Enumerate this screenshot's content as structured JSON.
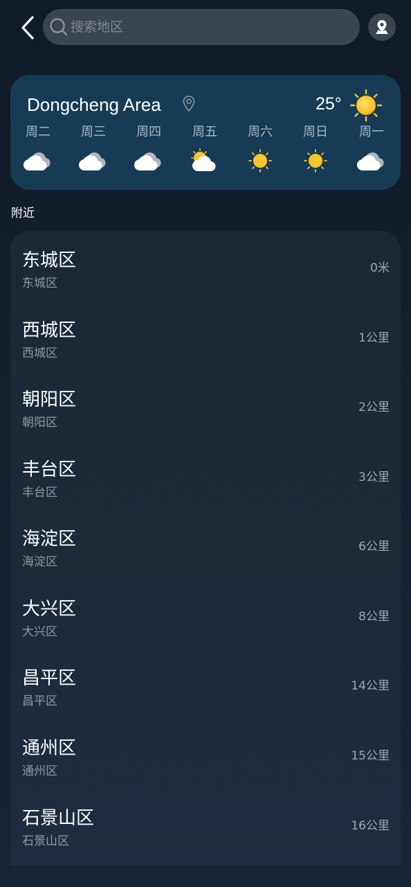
{
  "search": {
    "placeholder": "搜索地区"
  },
  "weather": {
    "city": "Dongcheng Area",
    "temperature": "25°",
    "forecast": [
      {
        "day": "周二",
        "icon": "cloudy-icon"
      },
      {
        "day": "周三",
        "icon": "cloudy-icon"
      },
      {
        "day": "周四",
        "icon": "cloudy-icon"
      },
      {
        "day": "周五",
        "icon": "partly-sunny-icon"
      },
      {
        "day": "周六",
        "icon": "sunny-icon"
      },
      {
        "day": "周日",
        "icon": "sunny-icon"
      },
      {
        "day": "周一",
        "icon": "cloudy-icon"
      }
    ]
  },
  "nearby": {
    "title": "附近",
    "items": [
      {
        "name": "东城区",
        "sub": "东城区",
        "distance": "0米"
      },
      {
        "name": "西城区",
        "sub": "西城区",
        "distance": "1公里"
      },
      {
        "name": "朝阳区",
        "sub": "朝阳区",
        "distance": "2公里"
      },
      {
        "name": "丰台区",
        "sub": "丰台区",
        "distance": "3公里"
      },
      {
        "name": "海淀区",
        "sub": "海淀区",
        "distance": "6公里"
      },
      {
        "name": "大兴区",
        "sub": "大兴区",
        "distance": "8公里"
      },
      {
        "name": "昌平区",
        "sub": "昌平区",
        "distance": "14公里"
      },
      {
        "name": "通州区",
        "sub": "通州区",
        "distance": "15公里"
      },
      {
        "name": "石景山区",
        "sub": "石景山区",
        "distance": "16公里"
      }
    ]
  },
  "colors": {
    "background": "#111a27",
    "card": "#173b55",
    "list": "#1b2836",
    "sun": "#f7c531"
  }
}
